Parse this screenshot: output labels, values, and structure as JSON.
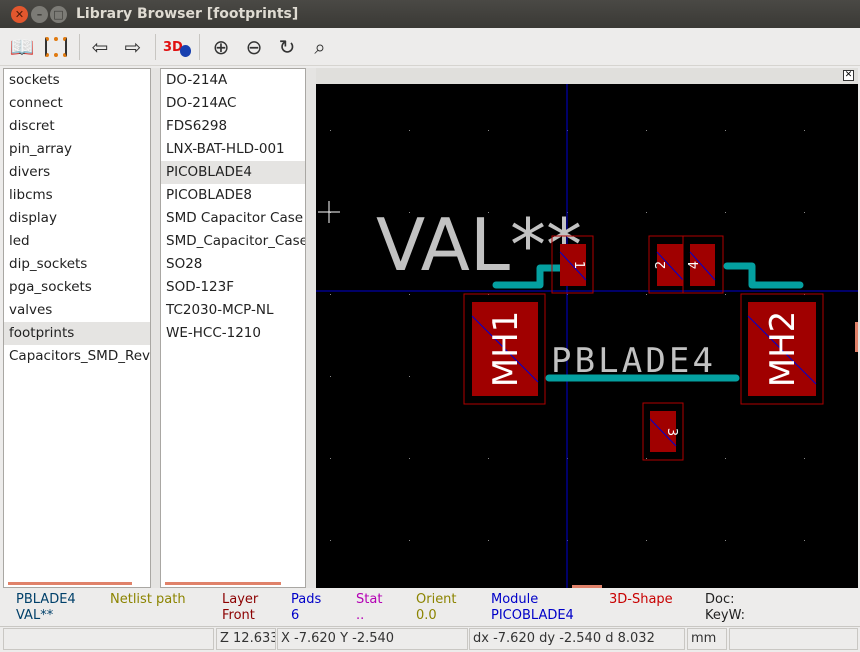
{
  "window": {
    "title": "Library Browser [footprints]"
  },
  "toolbar": {
    "icons": [
      "select-library-icon",
      "select-footprint-icon",
      "previous-footprint-icon",
      "next-footprint-icon",
      "3d-view-icon",
      "zoom-in-icon",
      "zoom-out-icon",
      "redraw-icon",
      "zoom-fit-icon"
    ],
    "label_3d": "3D"
  },
  "libraries": [
    "sockets",
    "connect",
    "discret",
    "pin_array",
    "divers",
    "libcms",
    "display",
    "led",
    "dip_sockets",
    "pga_sockets",
    "valves",
    "footprints",
    "Capacitors_SMD_Rev"
  ],
  "selected_library": "footprints",
  "footprints": [
    "DO-214A",
    "DO-214AC",
    "FDS6298",
    "LNX-BAT-HLD-001",
    "PICOBLADE4",
    "PICOBLADE8",
    "SMD Capacitor Case",
    "SMD_Capacitor_Case",
    "SO28",
    "SOD-123F",
    "TC2030-MCP-NL",
    "WE-HCC-1210"
  ],
  "selected_footprint": "PICOBLADE4",
  "canvas": {
    "value_text": "VAL**",
    "reference_text": "PBLADE4",
    "pads": [
      "1",
      "2",
      "3",
      "4"
    ],
    "mounting": [
      "MH1",
      "MH2"
    ]
  },
  "message_panel": [
    {
      "top": "PBLADE4",
      "bottom": "VAL**",
      "color": "#00406a"
    },
    {
      "top": "Netlist path",
      "bottom": "",
      "color": "#8c8400"
    },
    {
      "top": "Layer",
      "bottom": "Front",
      "color": "#8c0000"
    },
    {
      "top": "Pads",
      "bottom": "6",
      "color": "#0000c8"
    },
    {
      "top": "Stat",
      "bottom": "..",
      "color": "#b400b4"
    },
    {
      "top": "Orient",
      "bottom": "0.0",
      "color": "#8c8400"
    },
    {
      "top": "Module",
      "bottom": "PICOBLADE4",
      "color": "#0000c8"
    },
    {
      "top": "3D-Shape",
      "bottom": "",
      "color": "#c80000"
    },
    {
      "top": "Doc:",
      "bottom": "KeyW:",
      "color": "#222222"
    }
  ],
  "status": {
    "field1": "",
    "zoom": "Z 12.633",
    "coords": "X -7.620  Y -2.540",
    "delta": "dx -7.620  dy -2.540  d 8.032",
    "units": "mm",
    "field6": ""
  }
}
